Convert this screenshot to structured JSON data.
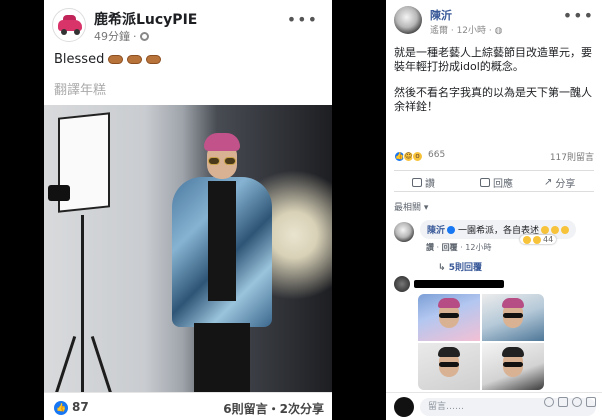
{
  "left_post": {
    "author": "鹿希派LucyPIE",
    "time": "49分鐘",
    "text": "Blessed",
    "translate": "翻譯年糕",
    "likes": "87",
    "stats": "6則留言・2次分享"
  },
  "right_post": {
    "author": "陳沂",
    "meta": "遙爾 · 12小時 · ",
    "paragraphs": [
      "就是一種老藝人上綜藝節目改造單元，要裝年輕打扮成idol的概念。",
      "然後不看名字我真的以為是天下第一醜人余祥銓！"
    ],
    "reaction_count": "665",
    "comment_count": "117則留言",
    "actions": [
      "讚",
      "回應",
      "分享"
    ],
    "sort_label": "最相關",
    "comments": [
      {
        "author": "陳沂",
        "text": "一園希派，各自表述",
        "reactions": "44",
        "like_label": "讚",
        "reply_label": "回覆",
        "time": "12小時",
        "replies_label": "5則回覆"
      }
    ],
    "compose_placeholder": "留言……"
  },
  "colors": {
    "facebook_blue": "#1877f2",
    "name_blue": "#385898",
    "hair_pink": "#c2528a"
  }
}
